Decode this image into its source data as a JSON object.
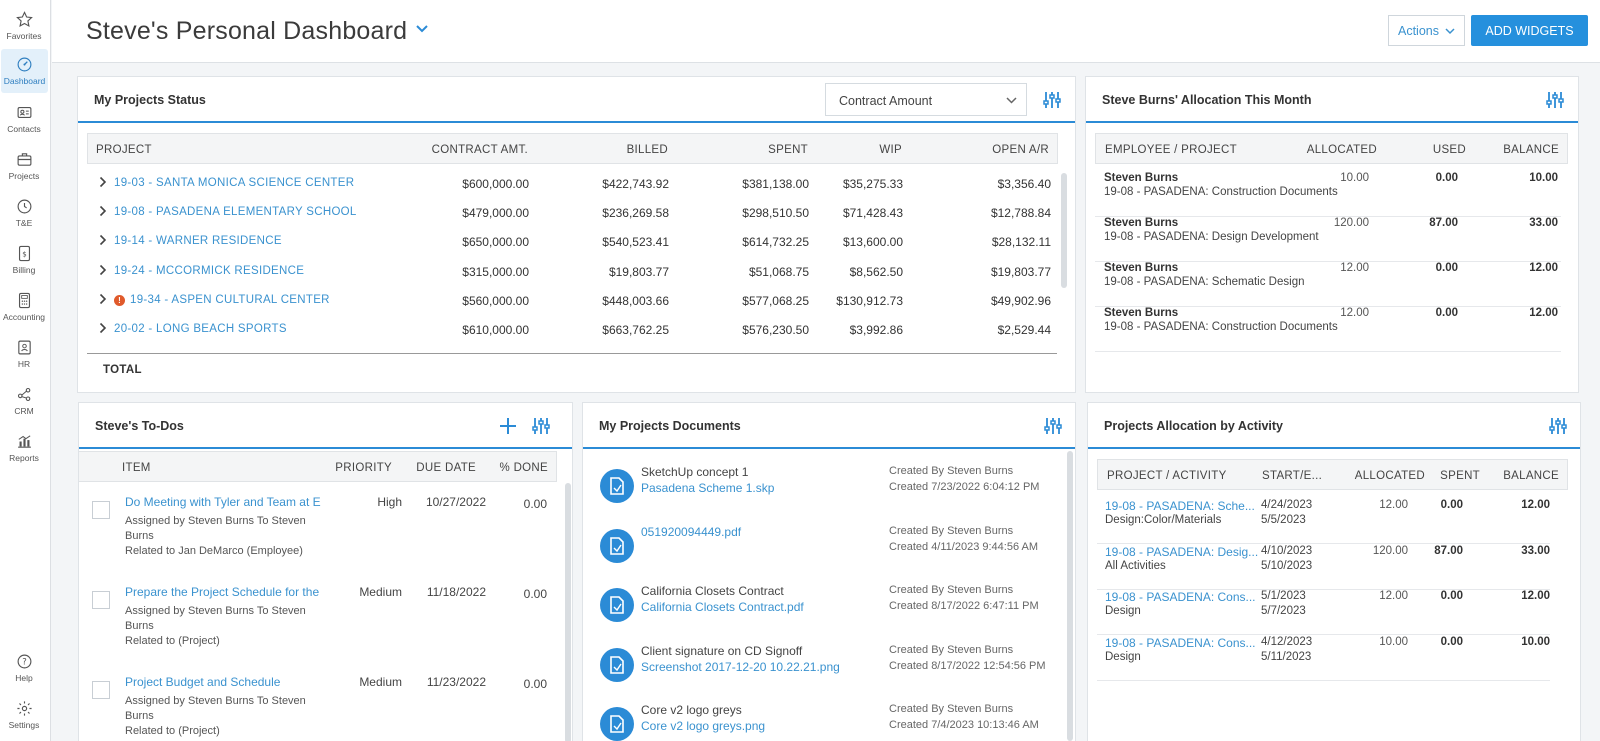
{
  "nav": [
    {
      "label": "Favorites",
      "icon": "star-icon"
    },
    {
      "label": "Dashboard",
      "icon": "dashboard-icon"
    },
    {
      "label": "Contacts",
      "icon": "contacts-icon"
    },
    {
      "label": "Projects",
      "icon": "projects-icon"
    },
    {
      "label": "T&E",
      "icon": "clock-icon"
    },
    {
      "label": "Billing",
      "icon": "billing-icon"
    },
    {
      "label": "Accounting",
      "icon": "calculator-icon"
    },
    {
      "label": "HR",
      "icon": "hr-icon"
    },
    {
      "label": "CRM",
      "icon": "crm-icon"
    },
    {
      "label": "Reports",
      "icon": "reports-icon"
    }
  ],
  "nav_bottom": [
    {
      "label": "Help",
      "icon": "help-icon"
    },
    {
      "label": "Settings",
      "icon": "gear-icon"
    }
  ],
  "header": {
    "title": "Steve's Personal Dashboard",
    "actions_label": "Actions",
    "add_widgets_label": "ADD WIDGETS"
  },
  "colors": {
    "accent": "#2590dd",
    "link": "#3a92cf",
    "alert": "#e05a2b"
  },
  "projects_status": {
    "title": "My Projects Status",
    "select_value": "Contract Amount",
    "columns": [
      "PROJECT",
      "CONTRACT AMT.",
      "BILLED",
      "SPENT",
      "WIP",
      "OPEN A/R"
    ],
    "rows": [
      {
        "project": "19-03 - SANTA MONICA SCIENCE CENTER",
        "contract": "$600,000.00",
        "billed": "$422,743.92",
        "spent": "$381,138.00",
        "wip": "$35,275.33",
        "open_ar": "$3,356.40",
        "alert": false
      },
      {
        "project": "19-08 - PASADENA ELEMENTARY SCHOOL",
        "contract": "$479,000.00",
        "billed": "$236,269.58",
        "spent": "$298,510.50",
        "wip": "$71,428.43",
        "open_ar": "$12,788.84",
        "alert": false
      },
      {
        "project": "19-14 - WARNER RESIDENCE",
        "contract": "$650,000.00",
        "billed": "$540,523.41",
        "spent": "$614,732.25",
        "wip": "$13,600.00",
        "open_ar": "$28,132.11",
        "alert": false
      },
      {
        "project": "19-24 - MCCORMICK RESIDENCE",
        "contract": "$315,000.00",
        "billed": "$19,803.77",
        "spent": "$51,068.75",
        "wip": "$8,562.50",
        "open_ar": "$19,803.77",
        "alert": false
      },
      {
        "project": "19-34 - ASPEN CULTURAL CENTER",
        "contract": "$560,000.00",
        "billed": "$448,003.66",
        "spent": "$577,068.25",
        "wip": "$130,912.73",
        "open_ar": "$49,902.96",
        "alert": true
      },
      {
        "project": "20-02 - LONG BEACH SPORTS",
        "contract": "$610,000.00",
        "billed": "$663,762.25",
        "spent": "$576,230.50",
        "wip": "$3,992.86",
        "open_ar": "$2,529.44",
        "alert": false
      }
    ],
    "total_label": "TOTAL"
  },
  "allocation_month": {
    "title": "Steve Burns' Allocation This Month",
    "columns": [
      "EMPLOYEE / PROJECT",
      "ALLOCATED",
      "USED",
      "BALANCE"
    ],
    "rows": [
      {
        "employee": "Steven Burns",
        "project": "19-08 - PASADENA: Construction Documents",
        "allocated": "10.00",
        "used": "0.00",
        "balance": "10.00"
      },
      {
        "employee": "Steven Burns",
        "project": "19-08 - PASADENA: Design Development",
        "allocated": "120.00",
        "used": "87.00",
        "balance": "33.00"
      },
      {
        "employee": "Steven Burns",
        "project": "19-08 - PASADENA: Schematic Design",
        "allocated": "12.00",
        "used": "0.00",
        "balance": "12.00"
      },
      {
        "employee": "Steven Burns",
        "project": "19-08 - PASADENA: Construction Documents",
        "allocated": "12.00",
        "used": "0.00",
        "balance": "12.00"
      }
    ]
  },
  "todos": {
    "title": "Steve's To-Dos",
    "columns": [
      "ITEM",
      "PRIORITY",
      "DUE DATE",
      "% DONE"
    ],
    "rows": [
      {
        "item": "Do Meeting with Tyler and Team at E",
        "assigned1": "Assigned by Steven Burns To Steven",
        "assigned2": "Burns",
        "related": "Related to Jan DeMarco (Employee)",
        "priority": "High",
        "due": "10/27/2022",
        "done": "0.00"
      },
      {
        "item": "Prepare the Project Schedule for the",
        "assigned1": "Assigned by Steven Burns To Steven",
        "assigned2": "Burns",
        "related": "Related to (Project)",
        "priority": "Medium",
        "due": "11/18/2022",
        "done": "0.00"
      },
      {
        "item": "Project Budget and Schedule",
        "assigned1": "Assigned by Steven Burns To Steven",
        "assigned2": "Burns",
        "related": "Related to (Project)",
        "priority": "Medium",
        "due": "11/23/2022",
        "done": "0.00"
      }
    ]
  },
  "documents": {
    "title": "My Projects Documents",
    "rows": [
      {
        "name": "SketchUp concept 1",
        "file": "Pasadena Scheme 1.skp",
        "created_by": "Created By Steven Burns",
        "created": "Created 7/23/2022 6:04:12 PM"
      },
      {
        "name": "",
        "file": "051920094449.pdf",
        "created_by": "Created By Steven Burns",
        "created": "Created 4/11/2023 9:44:56 AM"
      },
      {
        "name": "California Closets Contract",
        "file": "California Closets Contract.pdf",
        "created_by": "Created By Steven Burns",
        "created": "Created 8/17/2022 6:47:11 PM"
      },
      {
        "name": "Client signature on CD Signoff",
        "file": "Screenshot 2017-12-20 10.22.21.png",
        "created_by": "Created By Steven Burns",
        "created": "Created 8/17/2022 12:54:56 PM"
      },
      {
        "name": "Core v2 logo greys",
        "file": "Core v2 logo greys.png",
        "created_by": "Created By Steven Burns",
        "created": "Created 7/4/2023 10:13:46 AM"
      }
    ]
  },
  "activity_alloc": {
    "title": "Projects Allocation by Activity",
    "columns": [
      "PROJECT / ACTIVITY",
      "START/E...",
      "ALLOCATED",
      "SPENT",
      "BALANCE"
    ],
    "rows": [
      {
        "project": "19-08 - PASADENA: Sche...",
        "activity": "Design:Color/Materials",
        "start": "4/24/2023",
        "end": "5/5/2023",
        "allocated": "12.00",
        "spent": "0.00",
        "balance": "12.00"
      },
      {
        "project": "19-08 - PASADENA: Desig...",
        "activity": "All Activities",
        "start": "4/10/2023",
        "end": "5/10/2023",
        "allocated": "120.00",
        "spent": "87.00",
        "balance": "33.00"
      },
      {
        "project": "19-08 - PASADENA: Cons...",
        "activity": "Design",
        "start": "5/1/2023",
        "end": "5/7/2023",
        "allocated": "12.00",
        "spent": "0.00",
        "balance": "12.00"
      },
      {
        "project": "19-08 - PASADENA: Cons...",
        "activity": "Design",
        "start": "4/12/2023",
        "end": "5/11/2023",
        "allocated": "10.00",
        "spent": "0.00",
        "balance": "10.00"
      }
    ]
  }
}
